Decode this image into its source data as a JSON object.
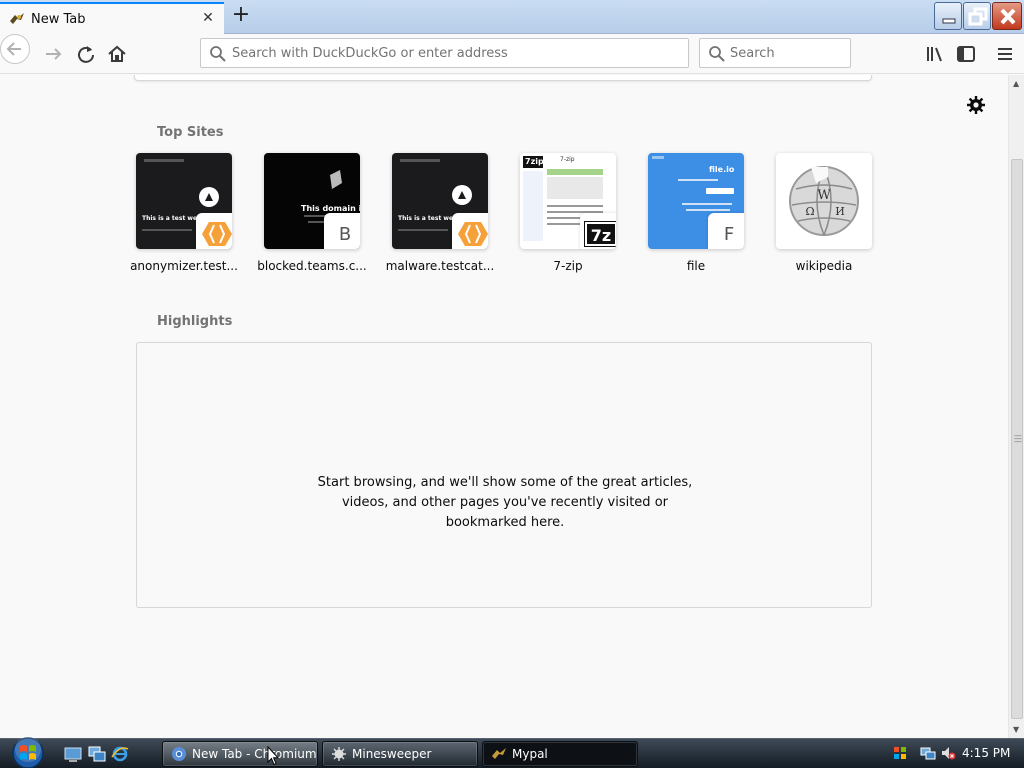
{
  "browser": {
    "tab_title": "New Tab",
    "url_placeholder": "Search with DuckDuckGo or enter address",
    "search_placeholder": "Search"
  },
  "newtab": {
    "top_sites_title": "Top Sites",
    "highlights_title": "Highlights",
    "highlights_empty_text": "Start browsing, and we'll show some of the great articles, videos, and other pages you've recently visited or bookmarked here.",
    "top_sites": [
      {
        "label": "anonymizer.test...",
        "thumb_caption": "This is a test website",
        "badge": "cloudflare-icon"
      },
      {
        "label": "blocked.teams.c...",
        "thumb_caption": "This domain is bloc",
        "badge_letter": "B"
      },
      {
        "label": "malware.testcat...",
        "thumb_caption": "This is a test website",
        "badge": "cloudflare-icon"
      },
      {
        "label": "7-zip",
        "thumb_caption": "7-zip",
        "badge": "7z-icon",
        "badge_text": "7z",
        "logo_text": "7zip"
      },
      {
        "label": "file",
        "thumb_caption": "file.io",
        "badge_letter": "F"
      },
      {
        "label": "wikipedia",
        "badge": "wikipedia-globe-icon"
      }
    ]
  },
  "taskbar": {
    "items": [
      {
        "label": "New Tab - Chromium",
        "icon": "chromium-icon",
        "active": true
      },
      {
        "label": "Minesweeper",
        "icon": "minesweeper-icon",
        "active": false
      },
      {
        "label": "Mypal",
        "icon": "mypal-icon",
        "active": false
      }
    ],
    "clock": "4:15 PM"
  },
  "colors": {
    "accent": "#0a84ff",
    "taskbar": "#1b232c",
    "tile_blue": "#3d8fe6"
  }
}
